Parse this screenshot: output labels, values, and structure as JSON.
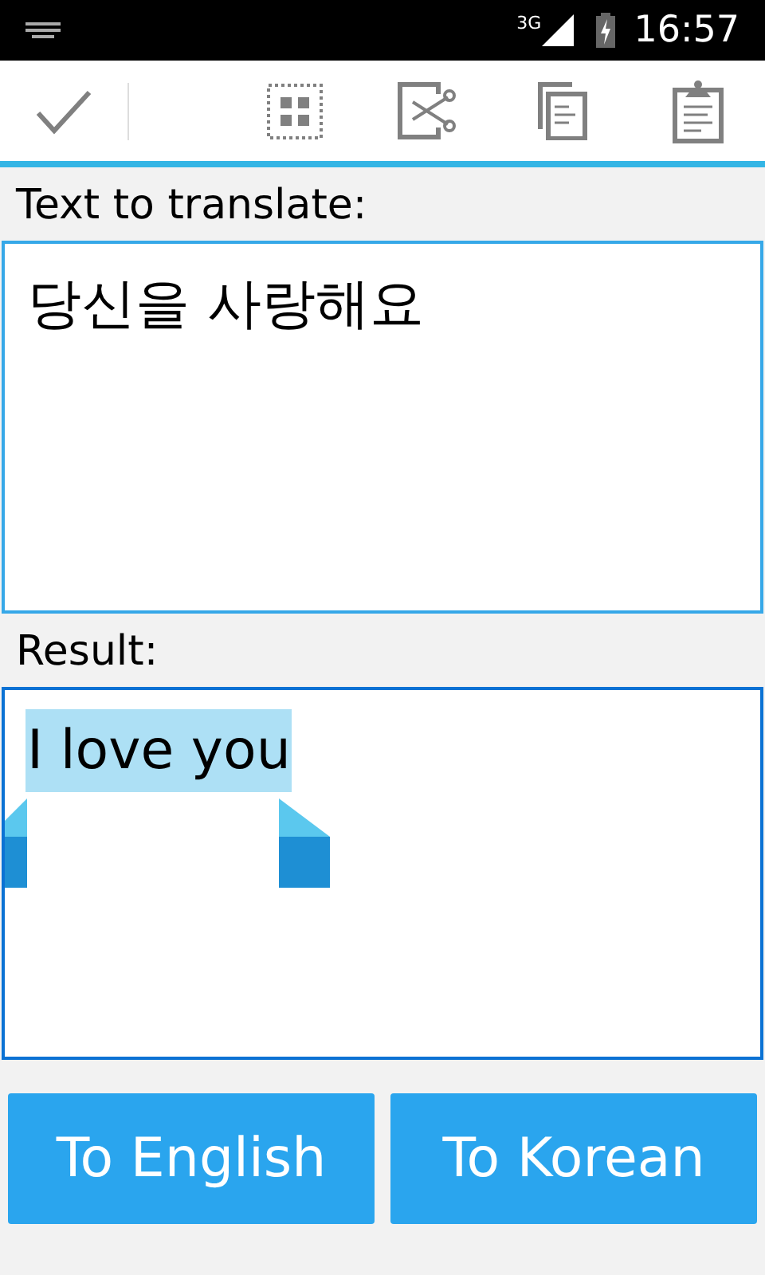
{
  "status_bar": {
    "time": "16:57",
    "network": "3G"
  },
  "source": {
    "label": "Text to translate:",
    "value": "당신을 사랑해요",
    "focused": false
  },
  "result": {
    "label": "Result:",
    "value": "I love you",
    "focused": true,
    "text_selected": true
  },
  "buttons": [
    {
      "label": "To English"
    },
    {
      "label": "To Korean"
    }
  ]
}
